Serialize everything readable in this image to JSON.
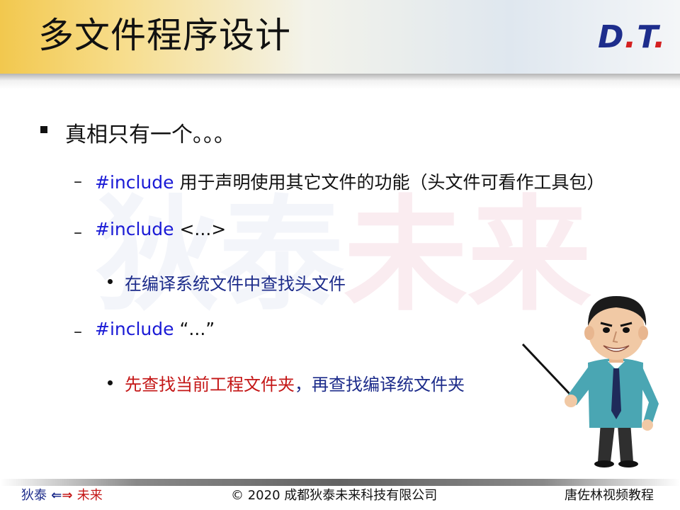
{
  "header": {
    "title": "多文件程序设计",
    "logo_left": "D",
    "logo_right": "T"
  },
  "watermark": {
    "part1": "狄泰",
    "part2": "未来"
  },
  "content": {
    "bullet_main": "真相只有一个。。。",
    "items": [
      {
        "keyword": "#include",
        "text": " 用于声明使用其它文件的功能（头文件可看作工具包）"
      },
      {
        "keyword": "#include",
        "text": " <...>"
      },
      {
        "sub": "在编译系统文件中查找头文件"
      },
      {
        "keyword": "#include",
        "text": "  “...”"
      },
      {
        "sub_red": "先查找当前工程文件夹",
        "sub_rest": "，再查找编译统文件夹"
      }
    ]
  },
  "footer": {
    "left_a": "狄泰",
    "left_b": "未来",
    "center": "© 2020 成都狄泰未来科技有限公司",
    "right": "唐佐林视频教程"
  },
  "icons": [
    "bullet-square-icon",
    "bullet-dash-icon",
    "bullet-dot-icon",
    "arrow-left-icon",
    "arrow-right-icon",
    "teacher-illustration"
  ],
  "colors": {
    "keyword": "#1a1ad6",
    "emphasis": "#c41616",
    "text_blue": "#1c2b8a",
    "logo": "#1d2d8c"
  }
}
